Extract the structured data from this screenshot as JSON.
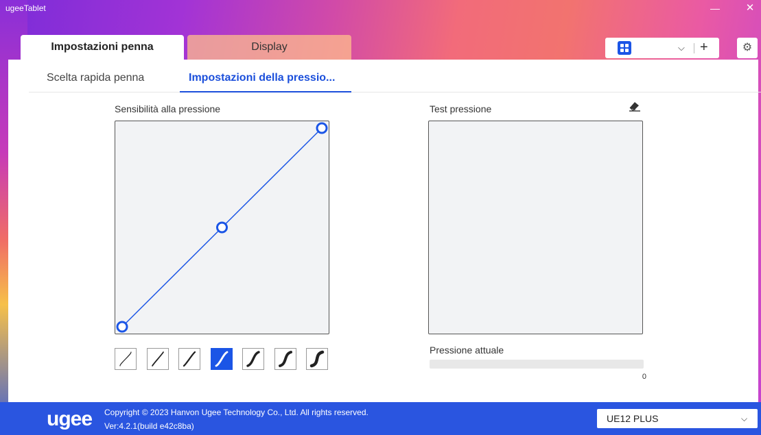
{
  "window": {
    "title": "ugeeTablet",
    "minimize_glyph": "—",
    "close_glyph": "✕"
  },
  "top_tabs": [
    {
      "label": "Impostazioni penna",
      "active": true
    },
    {
      "label": "Display",
      "active": false
    }
  ],
  "toolbar": {
    "app_icon": "app-grid-icon",
    "dropdown_glyph": "⌵",
    "add_glyph": "+",
    "settings_icon": "gear-icon",
    "settings_glyph": "⚙"
  },
  "sub_tabs": [
    {
      "label": "Scelta rapida penna",
      "active": false
    },
    {
      "label": "Impostazioni della pressio...",
      "active": true
    }
  ],
  "pressure_curve": {
    "label": "Sensibilità alla pressione",
    "control_points": [
      [
        0,
        0
      ],
      [
        0.5,
        0.5
      ],
      [
        1,
        1
      ]
    ],
    "preset_count": 7,
    "selected_preset": 3
  },
  "pressure_test": {
    "label": "Test pressione",
    "eraser_icon": "eraser-icon",
    "current_label": "Pressione attuale",
    "current_value": "0",
    "current_fraction": 0
  },
  "footer": {
    "brand": "ugee",
    "copyright": "Copyright © 2023 Hanvon Ugee Technology Co., Ltd. All rights reserved.",
    "version": "Ver:4.2.1(build e42c8ba)",
    "device": "UE12 PLUS",
    "device_chevron": "⌵"
  },
  "colors": {
    "accent": "#1b55e6",
    "footer": "#2a55e0"
  }
}
